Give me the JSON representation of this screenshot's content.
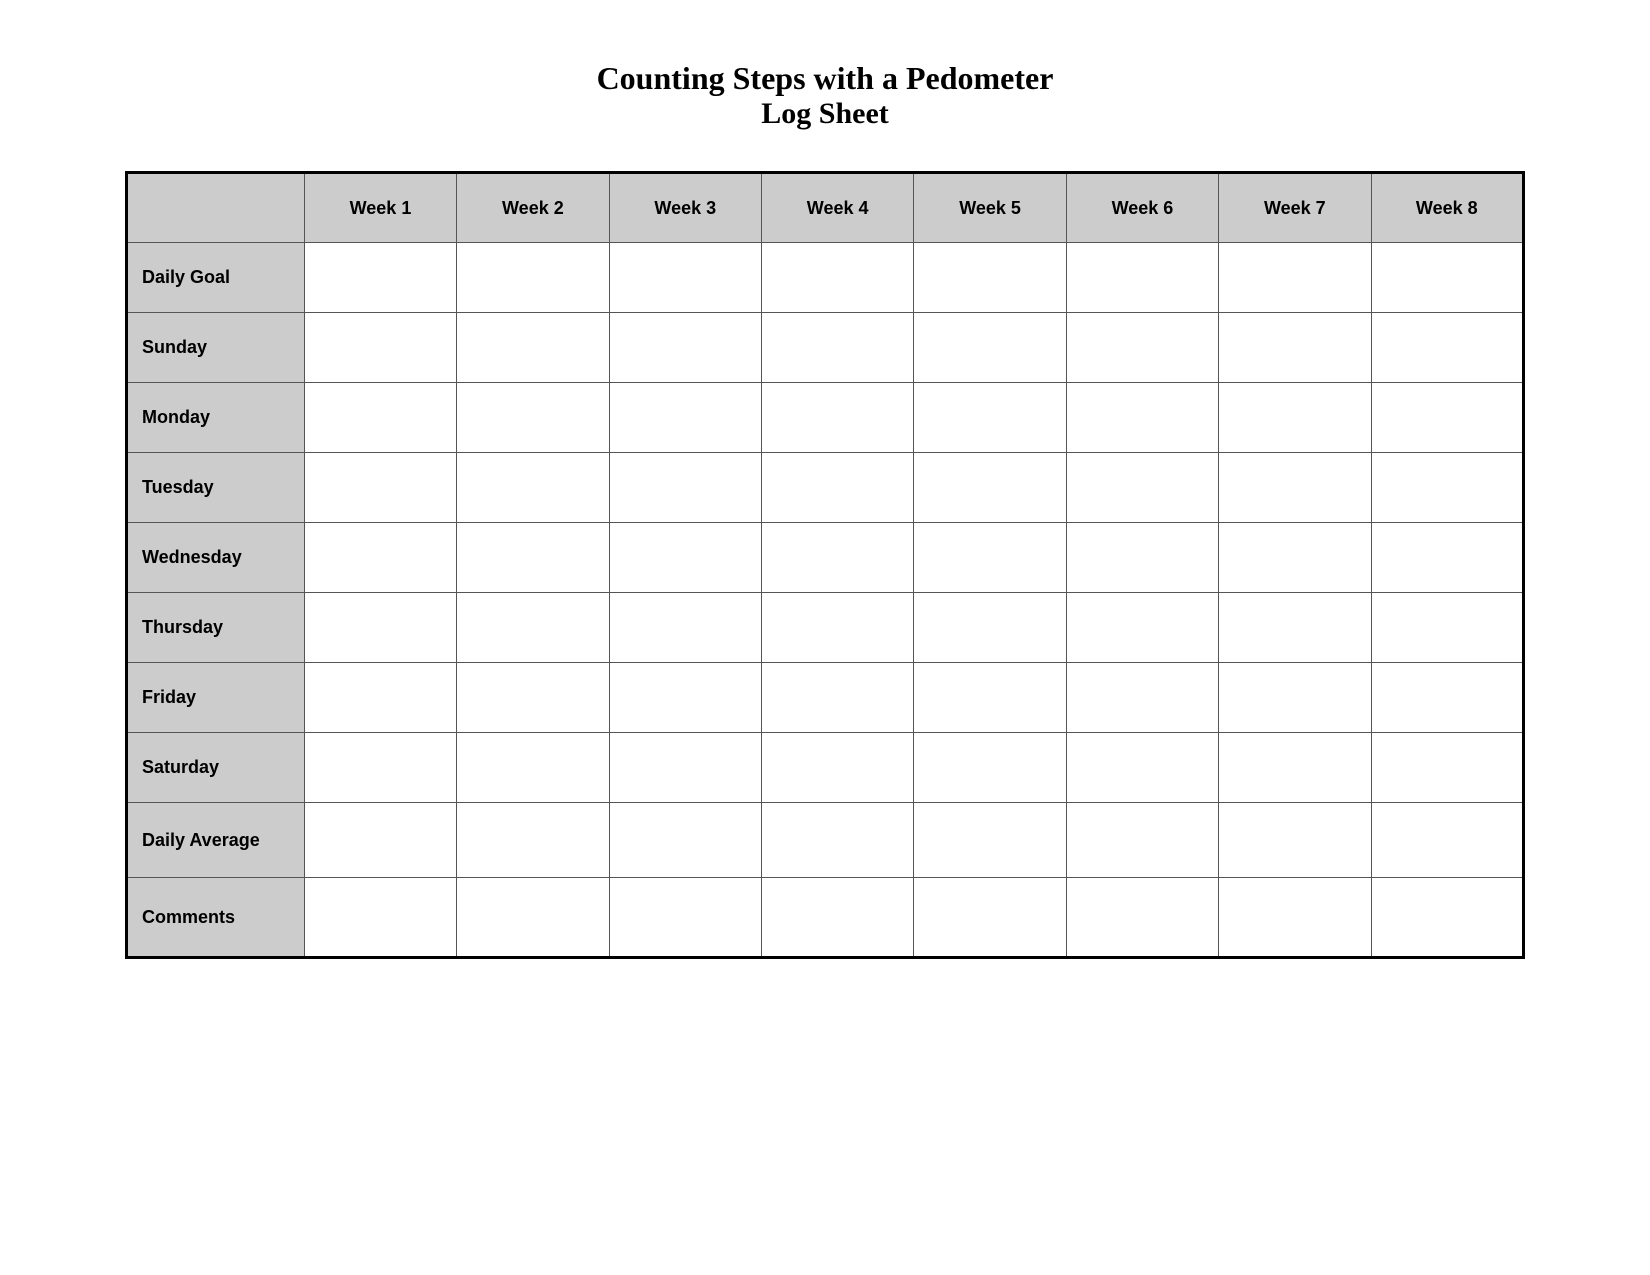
{
  "title": {
    "line1": "Counting Steps with a Pedometer",
    "line2": "Log Sheet"
  },
  "table": {
    "header_empty": "",
    "columns": [
      "Week 1",
      "Week 2",
      "Week 3",
      "Week 4",
      "Week 5",
      "Week 6",
      "Week 7",
      "Week 8"
    ],
    "rows": [
      {
        "label": "Daily Goal"
      },
      {
        "label": "Sunday"
      },
      {
        "label": "Monday"
      },
      {
        "label": "Tuesday"
      },
      {
        "label": "Wednesday"
      },
      {
        "label": "Thursday"
      },
      {
        "label": "Friday"
      },
      {
        "label": "Saturday"
      },
      {
        "label": "Daily Average",
        "class": "summary-row"
      },
      {
        "label": "Comments",
        "class": "comments-row"
      }
    ]
  }
}
